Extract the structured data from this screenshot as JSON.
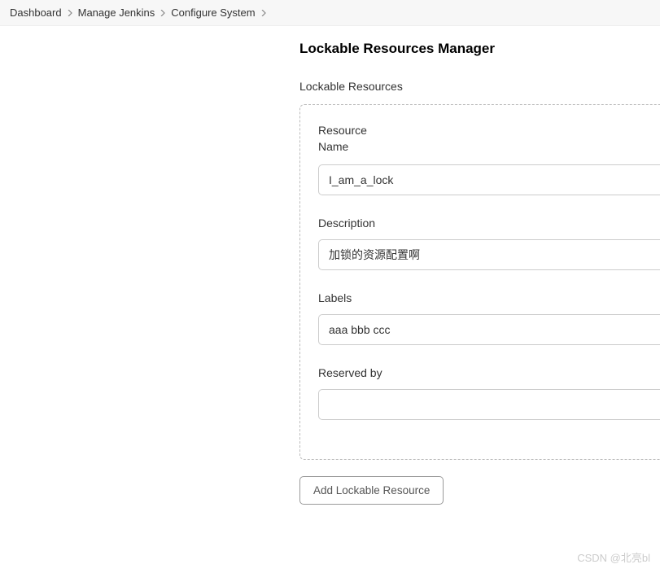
{
  "breadcrumb": {
    "items": [
      {
        "label": "Dashboard"
      },
      {
        "label": "Manage Jenkins"
      },
      {
        "label": "Configure System"
      }
    ]
  },
  "section": {
    "title": "Lockable Resources Manager",
    "subsection_label": "Lockable Resources",
    "resource": {
      "name_label": "Resource Name",
      "name_value": "I_am_a_lock",
      "description_label": "Description",
      "description_value": "加锁的资源配置啊",
      "labels_label": "Labels",
      "labels_value": "aaa bbb ccc",
      "reserved_label": "Reserved by",
      "reserved_value": ""
    },
    "add_button_label": "Add Lockable Resource"
  },
  "watermark": "CSDN @北亮bl"
}
